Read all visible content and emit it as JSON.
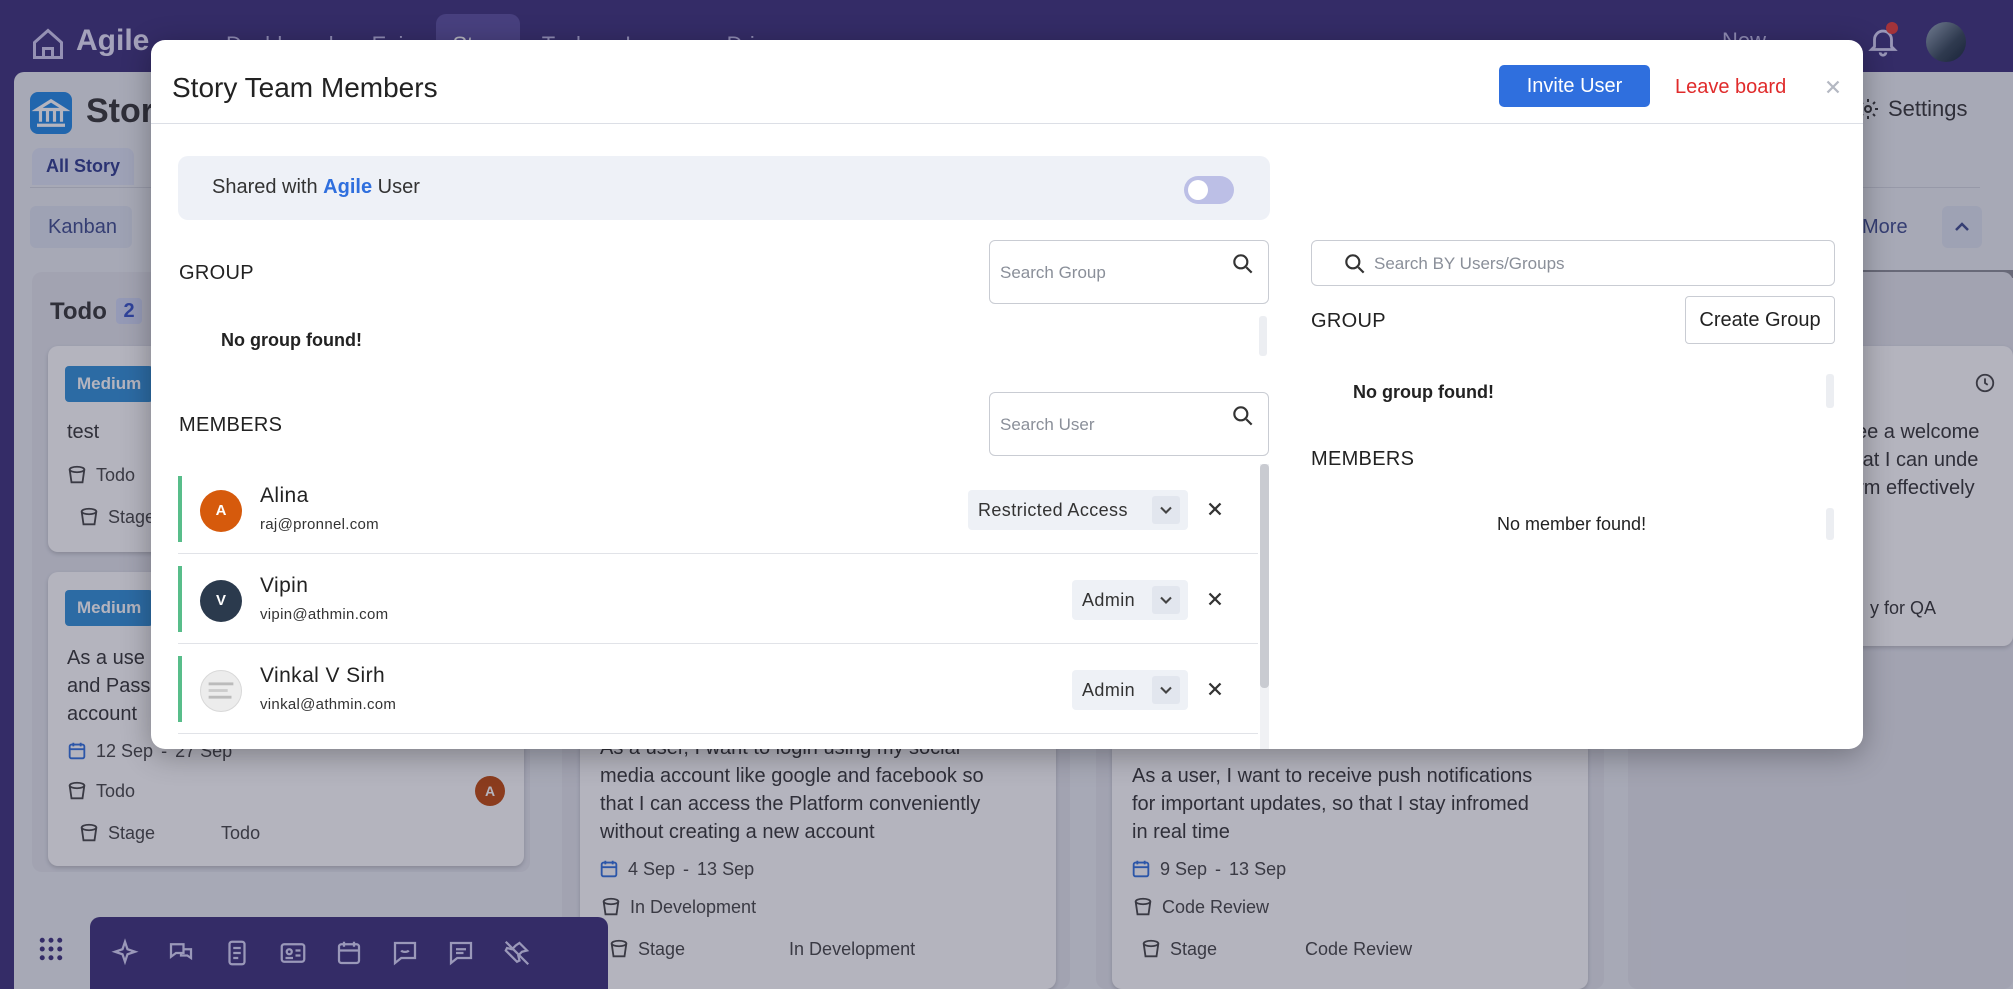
{
  "app": {
    "brand": "Agile",
    "nav": [
      "Dashboard",
      "Epic",
      "Story",
      "Task",
      "Issues",
      "Drive"
    ],
    "active_nav_index": 2,
    "new_label": "New",
    "page_title": "Story",
    "settings_label": "Settings",
    "subtab_label": "All Story",
    "view_label": "Kanban",
    "more_label": "More"
  },
  "board": {
    "todo_title": "Todo",
    "todo_count": "2",
    "card1": {
      "priority": "Medium",
      "title": "test",
      "status": "Todo",
      "stage_label": "Stage"
    },
    "card2": {
      "priority": "Medium",
      "text1": "As a use",
      "text2": "and Pass",
      "text3": "account",
      "date_start": "12 Sep",
      "date_sep": "-",
      "date_end": "27 Sep",
      "status": "Todo",
      "stage_label": "Stage",
      "stage_value": "Todo",
      "avatar": "A"
    },
    "card3": {
      "text1": "As a user, I want to login using my social",
      "text2": "media account like google and facebook so",
      "text3": "that I can access the Platform conveniently",
      "text4": "without creating a new account",
      "date_start": "4 Sep",
      "date_sep": "-",
      "date_end": "13 Sep",
      "status": "In Development",
      "stage_label": "Stage",
      "stage_value": "In Development"
    },
    "card4": {
      "text1": "As a user, I want to receive push notifications",
      "text2": "for important updates, so that I stay infromed",
      "text3": "in real time",
      "date_start": "9 Sep",
      "date_sep": "-",
      "date_end": "13 Sep",
      "status": "Code Review",
      "stage_label": "Stage",
      "stage_value": "Code Review"
    },
    "card5": {
      "text1": "see a welcome",
      "text2": "that I can unde",
      "text3": "orm effectively",
      "text4": "y for QA"
    }
  },
  "modal": {
    "title": "Story Team Members",
    "invite_label": "Invite User",
    "leave_label": "Leave board",
    "close_glyph": "×",
    "shared": {
      "prefix": "Shared with ",
      "highlight": "Agile",
      "suffix": " User",
      "enabled": false
    },
    "left": {
      "group_label": "GROUP",
      "group_search_placeholder": "Search Group",
      "group_empty": "No group found!",
      "members_label": "MEMBERS",
      "member_search_placeholder": "Search User",
      "members": [
        {
          "initial": "A",
          "name": "Alina",
          "email": "raj@pronnel.com",
          "role": "Restricted Access",
          "avatar_color": "#d65a0c"
        },
        {
          "initial": "V",
          "name": "Vipin",
          "email": "vipin@athmin.com",
          "role": "Admin",
          "avatar_color": "#2b3a4d"
        },
        {
          "initial": "",
          "name": "Vinkal V Sirh",
          "email": "vinkal@athmin.com",
          "role": "Admin",
          "avatar_color": "#e8e8e8"
        }
      ]
    },
    "right": {
      "search_placeholder": "Search BY Users/Groups",
      "group_label": "GROUP",
      "create_group_label": "Create Group",
      "group_empty": "No group found!",
      "members_label": "MEMBERS",
      "members_empty": "No member found!"
    }
  },
  "colors": {
    "primary": "#2f6fde",
    "danger": "#e02b2b",
    "accent_green": "#58bd8a",
    "topbar": "#3b2f7a",
    "badge": "#2e8fd8"
  }
}
